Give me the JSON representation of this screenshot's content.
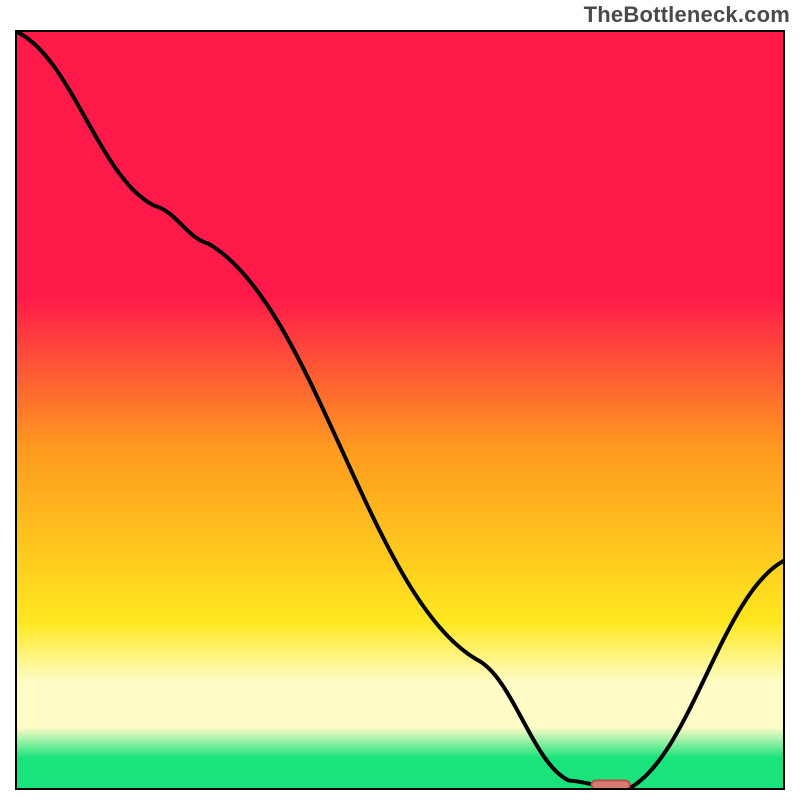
{
  "watermark": "TheBottleneck.com",
  "colors": {
    "red": "#ff1a49",
    "orange": "#ff9a1f",
    "yellow": "#ffe81f",
    "cream": "#fffcc7",
    "green": "#19e37a",
    "stroke": "#000000",
    "marker_fill": "#d77a72",
    "marker_stroke": "#b94f48"
  },
  "chart_data": {
    "type": "line",
    "title": "",
    "xlabel": "",
    "ylabel": "",
    "xlim": [
      0,
      100
    ],
    "ylim": [
      0,
      100
    ],
    "x": [
      0,
      18,
      25,
      60,
      72,
      78,
      80,
      100
    ],
    "y": [
      100,
      77,
      72,
      17,
      1,
      0,
      0,
      30
    ],
    "marker": {
      "x0": 75,
      "x1": 80,
      "y": 0,
      "thickness": 1.2
    },
    "gradient_stops_pct": [
      0,
      35,
      55,
      78,
      86,
      92,
      96,
      100
    ]
  }
}
